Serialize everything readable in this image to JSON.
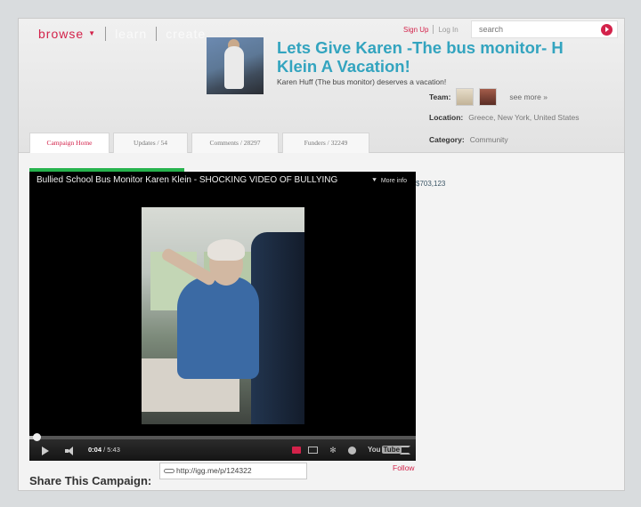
{
  "nav": {
    "browse": "browse",
    "learn": "learn",
    "create": "create"
  },
  "auth": {
    "sign_up": "Sign Up",
    "log_in": "Log In"
  },
  "search": {
    "placeholder": "search"
  },
  "campaign": {
    "title": "Lets Give Karen -The bus monitor- H Klein A Vacation!",
    "subtitle": "Karen Huff (The bus monitor) deserves a vacation!",
    "team_label": "Team:",
    "see_more": "see more »",
    "location_label": "Location:",
    "location": "Greece, New York, United States",
    "category_label": "Category:",
    "category": "Community",
    "funds_raised": "$703,123",
    "progress_fraction": 0.4
  },
  "tabs": [
    {
      "label": "Campaign Home",
      "active": true
    },
    {
      "label": "Updates / 54",
      "active": false
    },
    {
      "label": "Comments / 28297",
      "active": false
    },
    {
      "label": "Funders / 32249",
      "active": false
    }
  ],
  "video": {
    "title": "Bullied School Bus Monitor Karen Klein - SHOCKING VIDEO OF BULLYING",
    "more_info": "More info",
    "current_time": "0:04",
    "duration": "5:43",
    "played_fraction": 0.012,
    "logo": "You",
    "logo_tube": "Tube"
  },
  "share": {
    "follow": "Follow",
    "title": "Share This Campaign:",
    "url": "http://igg.me/p/124322"
  },
  "colors": {
    "brand": "#d3224a",
    "title": "#33a4bf",
    "progress": "#27b34e"
  },
  "icons": [
    "caret-down-icon",
    "search-icon",
    "link-icon",
    "play-icon",
    "volume-icon",
    "gear-icon",
    "fullscreen-icon"
  ]
}
